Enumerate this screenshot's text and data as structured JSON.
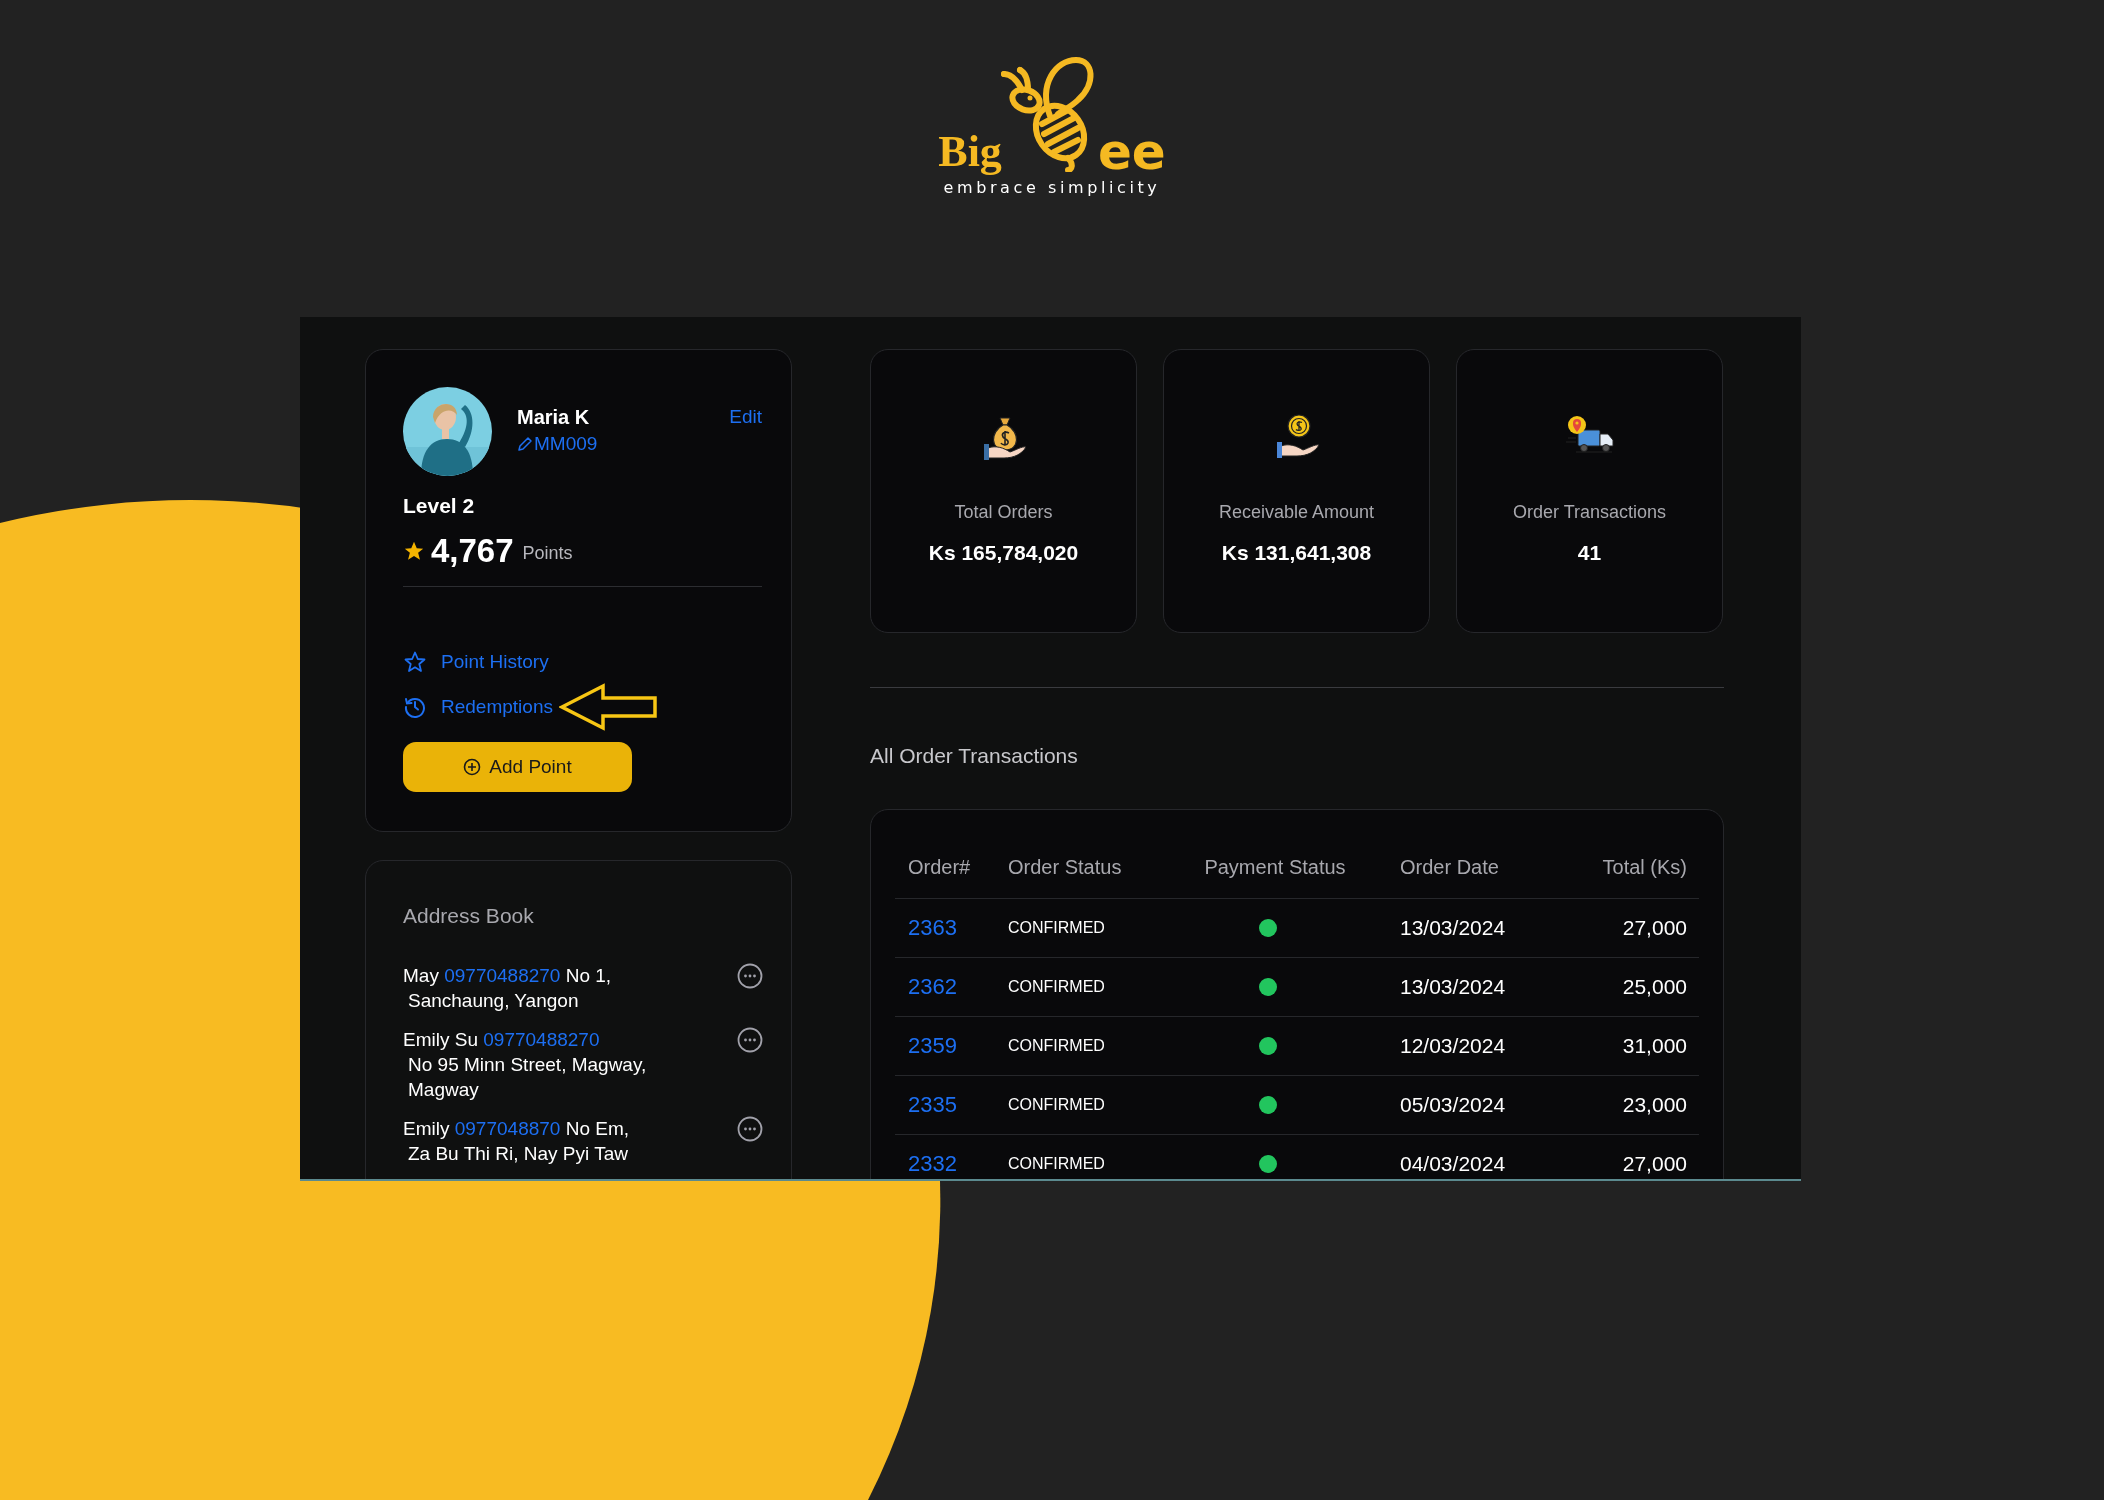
{
  "logo": {
    "word_left": "Big",
    "word_right": "ee",
    "tagline": "embrace simplicity"
  },
  "profile": {
    "name": "Maria K",
    "edit": "Edit",
    "code": "MM009",
    "level": "Level 2",
    "points": "4,767",
    "points_unit": "Points",
    "links": [
      {
        "label": "Point History",
        "marked_by_arrow": false
      },
      {
        "label": "Redemptions",
        "marked_by_arrow": true
      }
    ],
    "add_button": "Add Point"
  },
  "address_book": {
    "title": "Address Book",
    "entries": [
      {
        "name": "May",
        "phone": "09770488270",
        "after_phone": "No 1,",
        "lines": [
          "Sanchaung, Yangon"
        ]
      },
      {
        "name": "Emily Su",
        "phone": "09770488270",
        "lines": [
          "No 95 Minn Street, Magway,",
          "Magway"
        ]
      },
      {
        "name": "Emily",
        "phone": "0977048870",
        "after_phone": "No Em,",
        "lines": [
          "Za Bu Thi Ri, Nay Pyi Taw"
        ]
      }
    ]
  },
  "stats": [
    {
      "label": "Total Orders",
      "value": "Ks 165,784,020"
    },
    {
      "label": "Receivable Amount",
      "value": "Ks 131,641,308"
    },
    {
      "label": "Order Transactions",
      "value": "41"
    }
  ],
  "orders": {
    "title": "All Order Transactions",
    "columns": [
      "Order#",
      "Order Status",
      "Payment Status",
      "Order Date",
      "Total (Ks)"
    ],
    "rows": [
      {
        "order": "2363",
        "status": "CONFIRMED",
        "paid": true,
        "date": "13/03/2024",
        "total": "27,000"
      },
      {
        "order": "2362",
        "status": "CONFIRMED",
        "paid": true,
        "date": "13/03/2024",
        "total": "25,000"
      },
      {
        "order": "2359",
        "status": "CONFIRMED",
        "paid": true,
        "date": "12/03/2024",
        "total": "31,000"
      },
      {
        "order": "2335",
        "status": "CONFIRMED",
        "paid": true,
        "date": "05/03/2024",
        "total": "23,000"
      },
      {
        "order": "2332",
        "status": "CONFIRMED",
        "paid": true,
        "date": "04/03/2024",
        "total": "27,000"
      }
    ]
  }
}
